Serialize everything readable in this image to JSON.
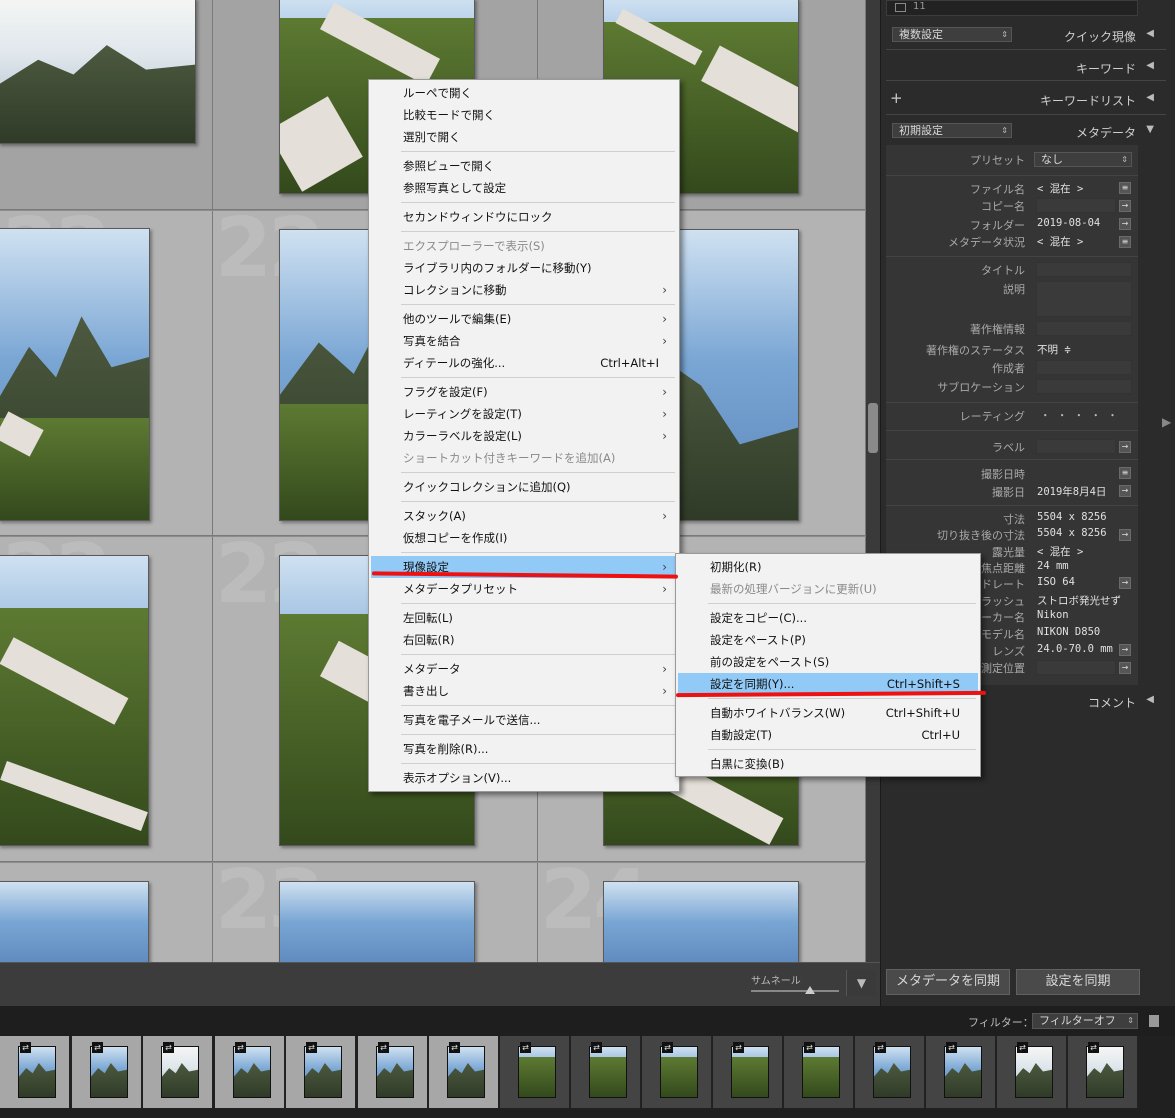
{
  "grid": {
    "cell_numbers": [
      "22",
      "22",
      "22",
      "22",
      "22",
      "22",
      "23",
      "24"
    ],
    "badge_icon": "⇄"
  },
  "toolbar": {
    "thumbnail_label": "サムネール",
    "sort_icon": "▼"
  },
  "panel": {
    "top_count": "11",
    "quick_dev": {
      "preset": "複数設定",
      "title": "クイック現像"
    },
    "keyword": {
      "title": "キーワード"
    },
    "keyword_list": {
      "title": "キーワードリスト",
      "add": "+"
    },
    "metadata": {
      "preset": "初期設定",
      "title": "メタデータ"
    },
    "preset_label": "プリセット",
    "preset_value": "なし",
    "fields": {
      "filename": {
        "label": "ファイル名",
        "value": "< 混在 >"
      },
      "copyname": {
        "label": "コピー名"
      },
      "folder": {
        "label": "フォルダー",
        "value": "2019-08-04"
      },
      "status": {
        "label": "メタデータ状況",
        "value": "< 混在 >"
      },
      "title": {
        "label": "タイトル"
      },
      "caption": {
        "label": "説明"
      },
      "copyright": {
        "label": "著作権情報"
      },
      "copyright_status": {
        "label": "著作権のステータス",
        "value": "不明 ≑"
      },
      "creator": {
        "label": "作成者"
      },
      "sublocation": {
        "label": "サブロケーション"
      },
      "rating": {
        "label": "レーティング",
        "value": "・ ・ ・ ・ ・"
      },
      "label": {
        "label": "ラベル"
      },
      "capture_time": {
        "label": "撮影日時"
      },
      "capture_date": {
        "label": "撮影日",
        "value": "2019年8月4日"
      },
      "dimensions": {
        "label": "寸法",
        "value": "5504 x 8256"
      },
      "cropped": {
        "label": "切り抜き後の寸法",
        "value": "5504 x 8256"
      },
      "exposure": {
        "label": "露光量",
        "value": "< 混在 >"
      },
      "focal": {
        "label": "焦点距離",
        "value": "24 mm"
      },
      "iso": {
        "label": "ードレート",
        "value": "ISO 64"
      },
      "flash": {
        "label": "フラッシュ",
        "value": "ストロボ発光せず"
      },
      "make": {
        "label": "ーカー名",
        "value": "Nikon"
      },
      "model": {
        "label": "モデル名",
        "value": "NIKON D850"
      },
      "lens": {
        "label": "レンズ",
        "value": "24.0-70.0 mm"
      },
      "gps": {
        "label": "測定位置"
      }
    },
    "comment": {
      "title": "コメント"
    },
    "sync_metadata_button": "メタデータを同期",
    "sync_settings_button": "設定を同期"
  },
  "filmstrip": {
    "filter_label": "フィルター：",
    "filter_value": "フィルターオフ"
  },
  "context_menu": {
    "items": [
      {
        "label": "ルーペで開く"
      },
      {
        "label": "比較モードで開く"
      },
      {
        "label": "選別で開く"
      },
      {
        "label": "参照ビューで開く"
      },
      {
        "label": "参照写真として設定"
      },
      {
        "label": "セカンドウィンドウにロック"
      },
      {
        "label": "エクスプローラーで表示(S)"
      },
      {
        "label": "ライブラリ内のフォルダーに移動(Y)"
      },
      {
        "label": "コレクションに移動"
      },
      {
        "label": "他のツールで編集(E)"
      },
      {
        "label": "写真を結合"
      },
      {
        "label": "ディテールの強化...",
        "shortcut": "Ctrl+Alt+I"
      },
      {
        "label": "フラグを設定(F)"
      },
      {
        "label": "レーティングを設定(T)"
      },
      {
        "label": "カラーラベルを設定(L)"
      },
      {
        "label": "ショートカット付きキーワードを追加(A)"
      },
      {
        "label": "クイックコレクションに追加(Q)"
      },
      {
        "label": "スタック(A)"
      },
      {
        "label": "仮想コピーを作成(I)"
      },
      {
        "label": "現像設定"
      },
      {
        "label": "メタデータプリセット"
      },
      {
        "label": "左回転(L)"
      },
      {
        "label": "右回転(R)"
      },
      {
        "label": "メタデータ"
      },
      {
        "label": "書き出し"
      },
      {
        "label": "写真を電子メールで送信..."
      },
      {
        "label": "写真を削除(R)..."
      },
      {
        "label": "表示オプション(V)..."
      }
    ],
    "submenu_arrow": "›"
  },
  "submenu": {
    "items": [
      {
        "label": "初期化(R)"
      },
      {
        "label": "最新の処理バージョンに更新(U)"
      },
      {
        "label": "設定をコピー(C)..."
      },
      {
        "label": "設定をペースト(P)"
      },
      {
        "label": "前の設定をペースト(S)"
      },
      {
        "label": "設定を同期(Y)...",
        "shortcut": "Ctrl+Shift+S"
      },
      {
        "label": "自動ホワイトバランス(W)",
        "shortcut": "Ctrl+Shift+U"
      },
      {
        "label": "自動設定(T)",
        "shortcut": "Ctrl+U"
      },
      {
        "label": "白黒に変換(B)"
      }
    ]
  },
  "colors": {
    "highlight": "#91c9f7",
    "annotation": "#e11111",
    "panel_bg": "#2b2b2b",
    "grid_bg": "#a3a3a3"
  }
}
